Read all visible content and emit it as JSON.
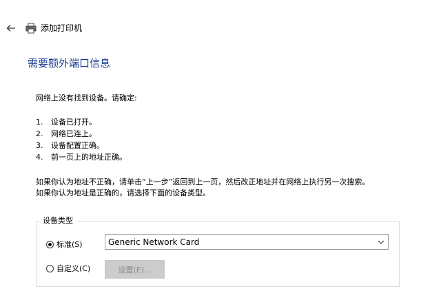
{
  "header": {
    "title": "添加打印机",
    "back_icon": "arrow-left-icon",
    "app_icon": "printer-icon"
  },
  "main": {
    "heading": "需要额外端口信息",
    "intro": "网络上没有找到设备。请确定:",
    "steps": [
      {
        "num": "1.",
        "text": "设备已打开。"
      },
      {
        "num": "2.",
        "text": "网络已连上。"
      },
      {
        "num": "3.",
        "text": "设备配置正确。"
      },
      {
        "num": "4.",
        "text": "前一页上的地址正确。"
      }
    ],
    "note_line1": "如果你认为地址不正确，请单击“上一步”返回到上一页，然后改正地址并在网络上执行另一次搜索。",
    "note_line2": "如果你认为地址是正确的，请选择下面的设备类型。"
  },
  "device_type": {
    "group_label": "设备类型",
    "standard_label": "标准(S)",
    "standard_selected": true,
    "standard_value": "Generic Network Card",
    "custom_label": "自定义(C)",
    "custom_selected": false,
    "settings_button": "设置(E)...",
    "settings_enabled": false
  },
  "colors": {
    "heading": "#1a3b8f",
    "disabled_button_bg": "#cccccc",
    "disabled_text": "#8a8a8a"
  }
}
